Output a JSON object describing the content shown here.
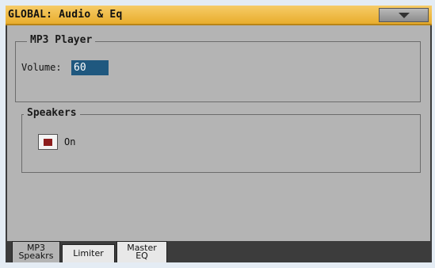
{
  "window": {
    "title": "GLOBAL: Audio & Eq",
    "menu_icon": "chevron-down-icon"
  },
  "mp3_player": {
    "title": "MP3 Player",
    "volume_label": "Volume:",
    "volume_value": "60"
  },
  "speakers": {
    "title": "Speakers",
    "on_label": "On",
    "on_checked": true
  },
  "tabs": [
    {
      "label": "MP3 Speakrs",
      "active": true
    },
    {
      "label": "Limiter",
      "active": false
    },
    {
      "label": "Master EQ",
      "active": false
    }
  ],
  "colors": {
    "title_bar": "#eeb43c",
    "panel": "#b4b4b4",
    "value_field": "#1f587f",
    "check_mark": "#8c1d1d"
  }
}
